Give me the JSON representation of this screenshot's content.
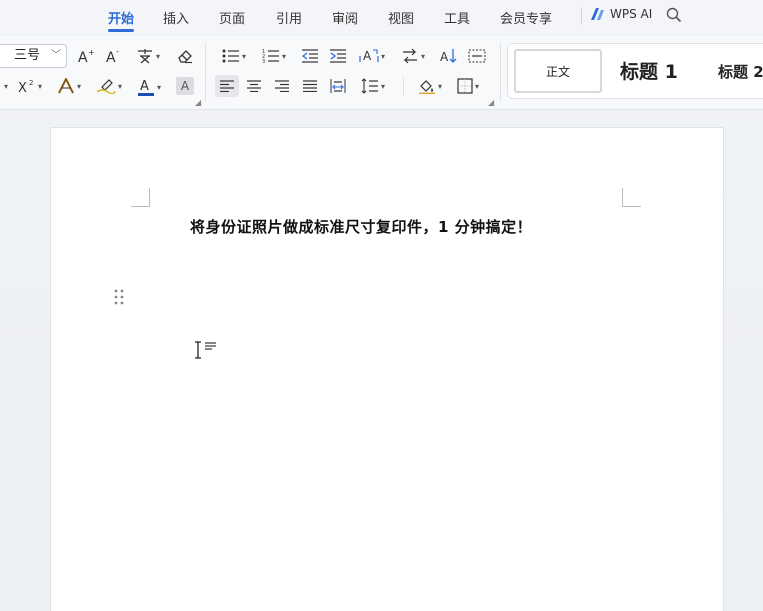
{
  "menu": {
    "tabs": [
      "开始",
      "插入",
      "页面",
      "引用",
      "审阅",
      "视图",
      "工具",
      "会员专享"
    ],
    "active_tab": "开始",
    "wps_ai": "WPS AI"
  },
  "ribbon": {
    "font_size": "三号",
    "font_color": "#1a4fb4",
    "styles": {
      "normal": "正文",
      "heading1": "标题 1",
      "heading2": "标题 2"
    }
  },
  "document": {
    "title": "将身份证照片做成标准尺寸复印件，1 分钟搞定！"
  }
}
